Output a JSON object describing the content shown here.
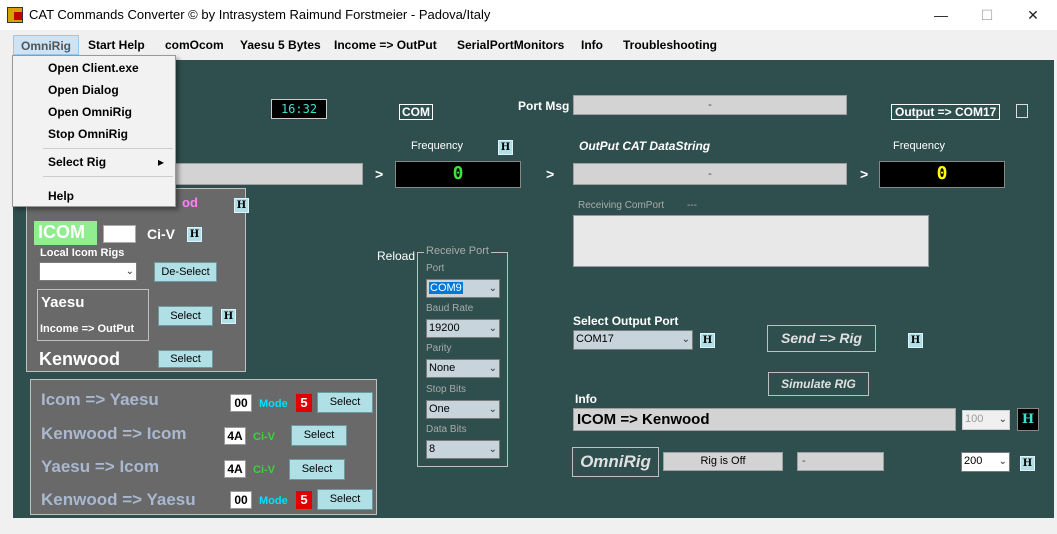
{
  "window": {
    "title": "CAT Commands Converter © by Intrasystem Raimund Forstmeier - Padova/Italy",
    "minimize": "—",
    "maximize": "☐",
    "close": "✕"
  },
  "menu": {
    "items": [
      "OmniRig",
      "Start Help",
      "comOcom",
      "Yaesu 5 Bytes",
      "Income => OutPut",
      "SerialPortMonitors",
      "Info",
      "Troubleshooting"
    ]
  },
  "omnirig_menu": {
    "items": [
      "Open Client.exe",
      "Open Dialog",
      "Open OmniRig",
      "Stop OmniRig",
      "Select Rig",
      "Help"
    ],
    "submenu_arrow": "▸"
  },
  "header": {
    "clock": "16:32",
    "com_label": "COM",
    "port_msg_label": "Port Msg",
    "port_msg_value": "-",
    "output_label": "Output => COM17"
  },
  "input_side": {
    "frequency_label": "Frequency",
    "frequency_value": "0",
    "h": "H",
    "arrow": ">"
  },
  "output_side": {
    "datastring_label": "OutPut CAT DataString",
    "datastring_value": "-",
    "frequency_label": "Frequency",
    "frequency_value": "0",
    "receiving_label": "Receiving ComPort",
    "receiving_dash": "---"
  },
  "rig_panel": {
    "title_partial": "od",
    "icom": "ICOM",
    "civ": "Ci-V",
    "local_icom_rigs": "Local Icom Rigs",
    "deselect": "De-Select",
    "yaesu": "Yaesu",
    "income_output": "Income => OutPut",
    "select": "Select",
    "kenwood": "Kenwood"
  },
  "conversions": [
    {
      "label": "Icom => Yaesu",
      "code": "00",
      "tag": "Mode",
      "num": "5",
      "btn": "Select"
    },
    {
      "label": "Kenwood => Icom",
      "code": "4A",
      "tag": "Ci-V",
      "btn": "Select"
    },
    {
      "label": "Yaesu => Icom",
      "code": "4A",
      "tag": "Ci-V",
      "btn": "Select"
    },
    {
      "label": "Kenwood => Yaesu",
      "code": "00",
      "tag": "Mode",
      "num": "5",
      "btn": "Select"
    }
  ],
  "receive_port": {
    "reload": "Reload",
    "group_label": "Receive Port",
    "port_label": "Port",
    "port_value": "COM9",
    "baud_label": "Baud Rate",
    "baud_value": "19200",
    "parity_label": "Parity",
    "parity_value": "None",
    "stop_label": "Stop Bits",
    "stop_value": "One",
    "data_label": "Data Bits",
    "data_value": "8"
  },
  "output_port": {
    "label": "Select Output Port",
    "value": "COM17",
    "send_rig": "Send  =>  Rig",
    "simulate": "Simulate RIG",
    "info_label": "Info",
    "info_value": "ICOM => Kenwood",
    "combo_100": "100",
    "omnirig_btn": "OmniRig",
    "rig_status": "Rig is Off",
    "status_dash": "-",
    "combo_200": "200"
  },
  "colors": {
    "panel": "#2f4f4f",
    "freq_text": "#ffff00",
    "light_cyan": "#b0e0e6",
    "icom_green": "#90ee90"
  }
}
